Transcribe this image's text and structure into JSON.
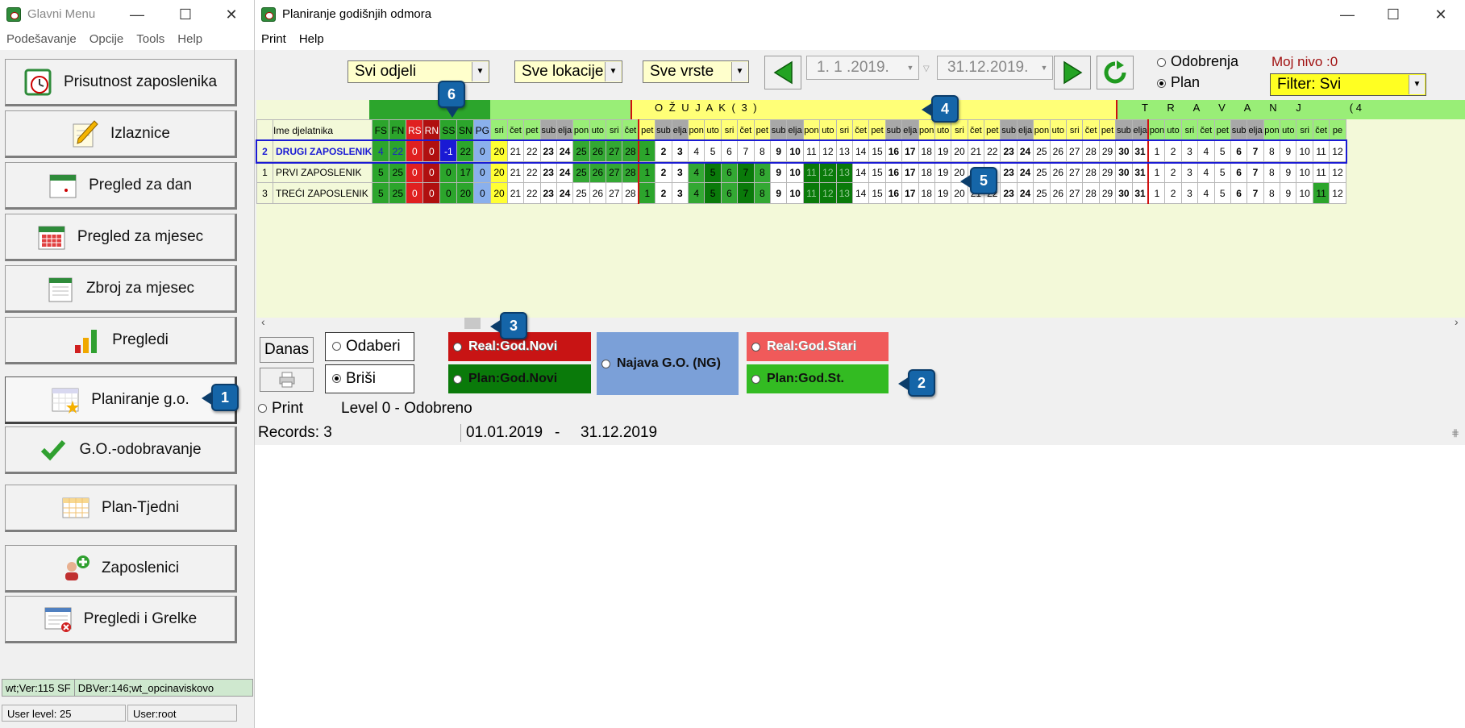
{
  "left_window": {
    "title": "Glavni Menu",
    "menu": [
      "Podešavanje",
      "Opcije",
      "Tools",
      "Help"
    ],
    "nav": [
      {
        "label": "Prisutnost zaposlenika",
        "icon": "clock-calendar-icon"
      },
      {
        "label": "Izlaznice",
        "icon": "pencil-note-icon"
      },
      {
        "label": "Pregled za dan",
        "icon": "calendar-day-icon"
      },
      {
        "label": "Pregled za mjesec",
        "icon": "calendar-month-icon"
      },
      {
        "label": "Zbroj za mjesec",
        "icon": "notepad-icon"
      },
      {
        "label": "Pregledi",
        "icon": "bar-chart-icon"
      },
      {
        "label": "Planiranje g.o.",
        "icon": "calendar-star-icon"
      },
      {
        "label": "G.O.-odobravanje",
        "icon": "checkmark-icon"
      },
      {
        "label": "Plan-Tjedni",
        "icon": "weekly-plan-icon"
      },
      {
        "label": "Zaposlenici",
        "icon": "add-user-icon"
      },
      {
        "label": "Pregledi i Grešk",
        "icon": "error-window-icon"
      }
    ],
    "nav_display": [
      "Prisutnost zaposlenika",
      "Izlaznice",
      "Pregled za dan",
      "Pregled za mjesec",
      "Zbroj za mjesec",
      "Pregledi",
      "Planiranje g.o.",
      "G.O.-odobravanje",
      "Plan-Tjedni",
      "Zaposlenici",
      "Pregledi i Grelke"
    ],
    "status_version": "wt;Ver:115 SF",
    "status_db": "DBVer:146;wt_opcinaviskovo",
    "status_level": "User level: 25",
    "status_user": "User:root"
  },
  "right_window": {
    "title": "Planiranje godišnjih odmora",
    "menu": [
      "Print",
      "Help"
    ],
    "dept_combo": "Svi odjeli",
    "location_combo": "Sve lokacije",
    "type_combo": "Sve vrste",
    "date_from": "1. 1 .2019.",
    "date_to": "31.12.2019.",
    "radio_odobrenja": "Odobrenja",
    "radio_plan": "Plan",
    "level_label": "Moj nivo :0",
    "filter": "Filter: Svi",
    "month_march": "O Ž U J A K     ( 3 )",
    "month_april": "T R A V A N J",
    "month_april_tail": "( 4",
    "col_headers": [
      "Ime djelatnika",
      "FS",
      "FN",
      "RS",
      "RN",
      "SS",
      "SN",
      "PG"
    ],
    "feb_days": [
      "sri",
      "čet",
      "pet",
      "sub",
      "elja",
      "pon",
      "uto",
      "sri",
      "čet"
    ],
    "mar_days": [
      "pet",
      "sub",
      "elja",
      "pon",
      "uto",
      "sri",
      "čet",
      "pet",
      "sub",
      "elja",
      "pon",
      "uto",
      "sri",
      "čet",
      "pet",
      "sub",
      "elja",
      "pon",
      "uto",
      "sri",
      "čet",
      "pet",
      "sub",
      "elja",
      "pon",
      "uto",
      "sri",
      "čet",
      "pet",
      "sub",
      "elja"
    ],
    "apr_days": [
      "pon",
      "uto",
      "sri",
      "čet",
      "pet",
      "sub",
      "elja",
      "pon",
      "uto",
      "sri",
      "čet",
      "pe"
    ],
    "rows": [
      {
        "id": "2",
        "name": "DRUGI ZAPOSLENIK",
        "fs": "4",
        "fn": "22",
        "rs": "0",
        "rn": "0",
        "ss": "-1",
        "sn": "22",
        "pg": "0",
        "selected": true
      },
      {
        "id": "1",
        "name": "PRVI ZAPOSLENIK",
        "fs": "5",
        "fn": "25",
        "rs": "0",
        "rn": "0",
        "ss": "0",
        "sn": "17",
        "pg": "0",
        "selected": false
      },
      {
        "id": "3",
        "name": "TREĆI ZAPOSLENIK",
        "fs": "5",
        "fn": "25",
        "rs": "0",
        "rn": "0",
        "ss": "0",
        "sn": "20",
        "pg": "0",
        "selected": false
      }
    ],
    "feb_nums": [
      "20",
      "21",
      "22",
      "23",
      "24",
      "25",
      "26",
      "27",
      "28"
    ],
    "apr_nums": [
      "1",
      "2",
      "3",
      "4",
      "5",
      "6",
      "7",
      "8",
      "9",
      "10",
      "11",
      "12"
    ],
    "btn_danas": "Danas",
    "radio_odaberi": "Odaberi",
    "radio_brisi": "Briši",
    "legend_real_novi": "Real:God.Novi",
    "legend_plan_novi": "Plan:God.Novi",
    "legend_najava": "Najava G.O. (NG)",
    "legend_real_stari": "Real:God.Stari",
    "legend_plan_stari": "Plan:God.St.",
    "radio_print": "Print",
    "level_text": "Level 0 - Odobreno",
    "records": "Records: 3",
    "range_from": "01.01.2019",
    "range_sep": "-",
    "range_to": "31.12.2019"
  },
  "callouts": [
    "1",
    "2",
    "3",
    "4",
    "5",
    "6"
  ],
  "colors": {
    "green": "#33a833",
    "dark_green": "#0a7a0a",
    "red": "#c81414",
    "yellow": "#ffff66",
    "blue": "#1a1ad4",
    "najava": "#7ba0d8",
    "light_red": "#f05a5a"
  }
}
